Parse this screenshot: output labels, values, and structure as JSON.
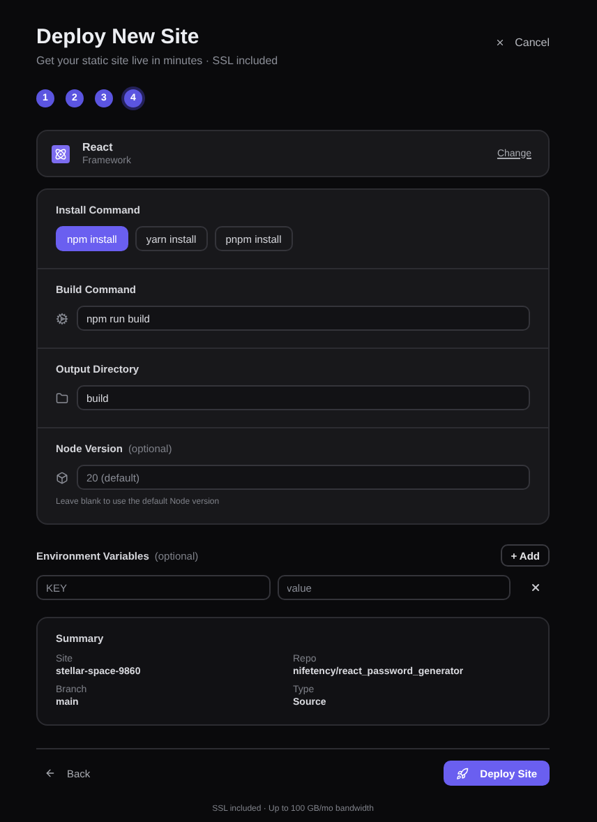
{
  "header": {
    "title": "Deploy New Site",
    "subtitle": "Get your static site live in minutes · SSL included",
    "cancel": "Cancel"
  },
  "steps": [
    {
      "label": "1",
      "selected": false
    },
    {
      "label": "2",
      "selected": false
    },
    {
      "label": "3",
      "selected": false
    },
    {
      "label": "4",
      "selected": true
    }
  ],
  "framework": {
    "name": "React",
    "caption": "Framework",
    "action": "Change"
  },
  "install": {
    "label": "Install Command",
    "options": [
      {
        "label": "npm install",
        "selected": true
      },
      {
        "label": "yarn install",
        "selected": false
      },
      {
        "label": "pnpm install",
        "selected": false
      }
    ]
  },
  "fields": [
    {
      "kind": "gear",
      "label": "Build Command",
      "value": "npm run build"
    },
    {
      "kind": "folder",
      "label": "Output Directory",
      "value": "build"
    },
    {
      "kind": "box",
      "label": "Node Version",
      "optional": "(optional)",
      "placeholder": "20 (default)",
      "hint": "Leave blank to use the default Node version"
    }
  ],
  "env": {
    "label": "Environment Variables",
    "optional": "(optional)",
    "add": "+ Add",
    "key_placeholder": "KEY",
    "value_placeholder": "value"
  },
  "summary": {
    "title": "Summary",
    "items": [
      {
        "label": "Site",
        "value": "stellar-space-9860"
      },
      {
        "label": "Repo",
        "value": "nifetency/react_password_generator"
      },
      {
        "label": "Branch",
        "value": "main"
      },
      {
        "label": "Type",
        "value": "Source"
      }
    ]
  },
  "footer": {
    "back": "Back",
    "deploy": "Deploy Site",
    "note": "SSL included · Up to 100 GB/mo bandwidth"
  }
}
